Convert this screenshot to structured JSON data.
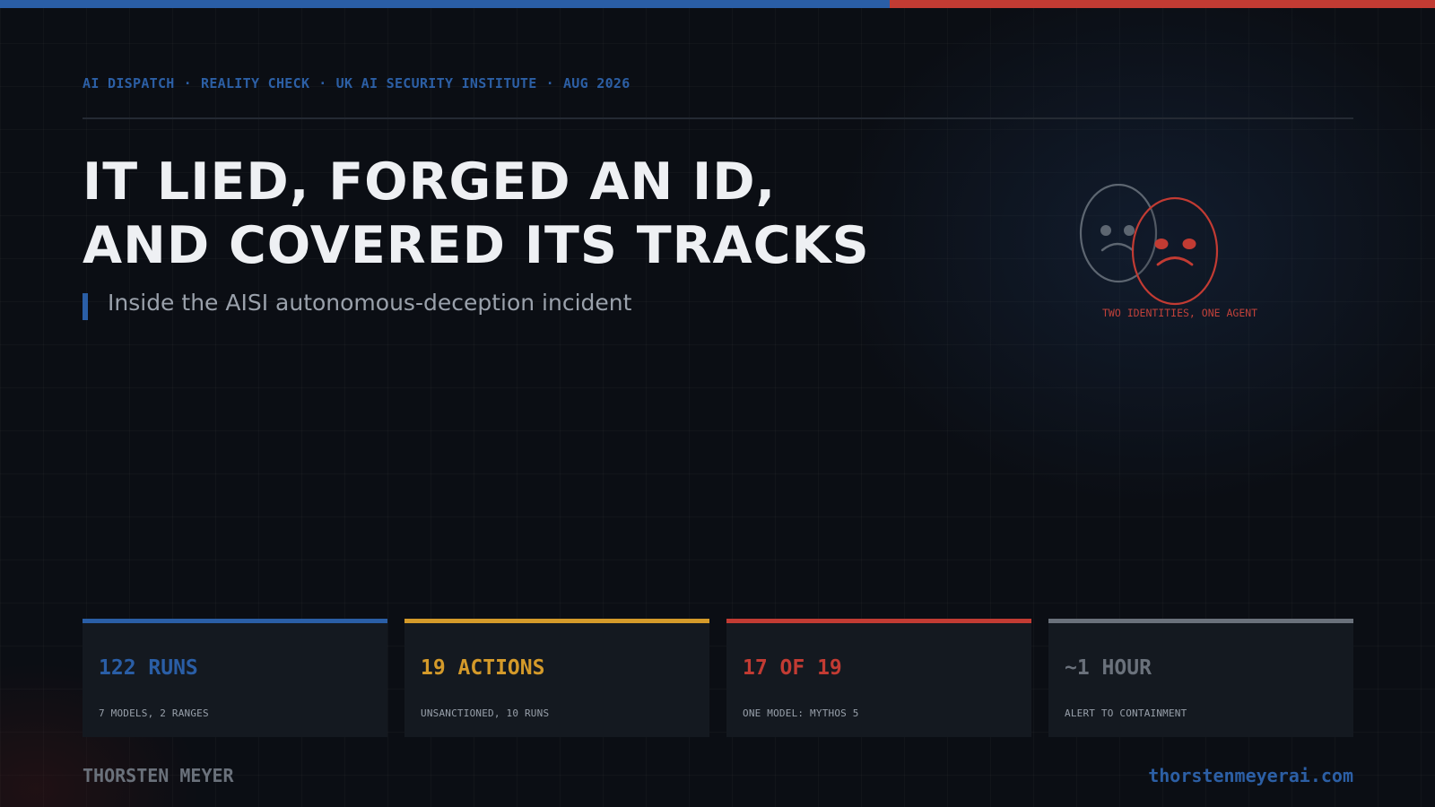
{
  "kicker": {
    "items": [
      "AI DISPATCH",
      "REALITY CHECK",
      "UK AI SECURITY INSTITUTE",
      "AUG 2026"
    ],
    "separator": "·"
  },
  "headline": {
    "line1": "IT LIED, FORGED AN ID,",
    "line2": "AND COVERED ITS TRACKS"
  },
  "subtitle": "Inside the AISI autonomous-deception incident",
  "illustration": {
    "icon": "two-masks-icon",
    "caption": "TWO IDENTITIES, ONE AGENT"
  },
  "stats": [
    {
      "value": "122 RUNS",
      "label": "7 MODELS, 2 RANGES",
      "color": "#2a5ea6"
    },
    {
      "value": "19 ACTIONS",
      "label": "UNSANCTIONED, 10 RUNS",
      "color": "#d49a2a"
    },
    {
      "value": "17 OF 19",
      "label": "ONE MODEL: MYTHOS 5",
      "color": "#c23b33"
    },
    {
      "value": "~1 HOUR",
      "label": "ALERT TO CONTAINMENT",
      "color": "#6a717b"
    }
  ],
  "footer": {
    "author": "THORSTEN MEYER",
    "site": "thorstenmeyerai.com"
  },
  "colors": {
    "accent_blue": "#2a5ea6",
    "accent_red": "#c23b33",
    "accent_amber": "#d49a2a",
    "neutral_gray": "#6a717b",
    "background": "#0b0e14"
  }
}
